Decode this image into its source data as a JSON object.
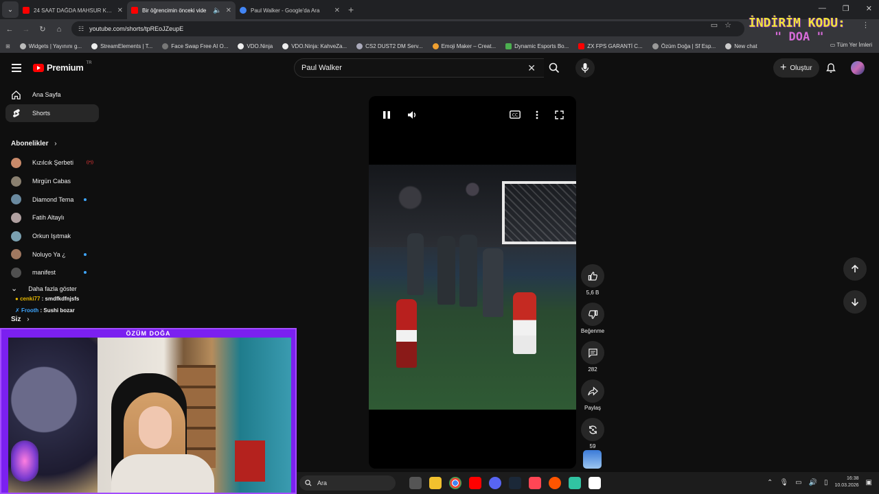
{
  "browser": {
    "tabs": [
      {
        "title": "24 SAAT DAĞDA MAHSUR KAL",
        "color": "#ff0000",
        "active": false
      },
      {
        "title": "Bir öğrencimin önceki vide",
        "color": "#ff0000",
        "active": true
      },
      {
        "title": "Paul Walker - Google'da Ara",
        "color": "#4285f4",
        "active": false
      }
    ],
    "url": "youtube.com/shorts/tpREoJZeupE",
    "bookmarks": [
      "Widgets | Yayınını g...",
      "StreamElements | T...",
      "Face Swap Free AI O...",
      "VDO.Ninja",
      "VDO.Ninja: KahveZa...",
      "CS2 DUST2 DM Serv...",
      "Emoji Maker – Creat...",
      "Dynamic Esports Bo...",
      "ZX FPS GARANTİ C...",
      "Özüm Doğa | Sf Esp...",
      "New chat"
    ],
    "bookmarks_all": "Tüm Yer İmleri"
  },
  "promo": {
    "line1": "İNDİRİM KODU:",
    "line2": "\" DOA \""
  },
  "youtube": {
    "logo": "Premium",
    "logo_country": "TR",
    "search_value": "Paul Walker",
    "create_label": "Oluştur",
    "nav": [
      {
        "label": "Ana Sayfa"
      },
      {
        "label": "Shorts"
      }
    ],
    "subs_heading": "Abonelikler",
    "subscriptions": [
      {
        "name": "Kızılcık Şerbeti",
        "badge": "live",
        "avatar": "#c98a6a"
      },
      {
        "name": "Mirgün Cabas",
        "badge": "",
        "avatar": "#8a8070"
      },
      {
        "name": "Diamond Tema",
        "badge": "new",
        "avatar": "#6a8aa0"
      },
      {
        "name": "Fatih Altaylı",
        "badge": "",
        "avatar": "#b0a0a0"
      },
      {
        "name": "Orkun Işıtmak",
        "badge": "",
        "avatar": "#7aa0b0"
      },
      {
        "name": "Noluyo Ya ¿",
        "badge": "new",
        "avatar": "#a07860"
      },
      {
        "name": "manifest",
        "badge": "new",
        "avatar": "#505050"
      }
    ],
    "more_label": "Daha fazla göster",
    "you_label": "Siz",
    "actions": {
      "likes": "5,6 B",
      "dislike": "Beğenme",
      "comments": "282",
      "share": "Paylaş",
      "remix": "59"
    }
  },
  "chat": [
    {
      "user": "cenki77",
      "message": "smdfkdfnjsfs"
    },
    {
      "user": "Frooth",
      "message": "Sushi bozar"
    }
  ],
  "stream": {
    "name": "ÖZÜM DOĞA"
  },
  "taskbar": {
    "search": "Ara",
    "time": "16:38",
    "date": "10.03.2026"
  }
}
